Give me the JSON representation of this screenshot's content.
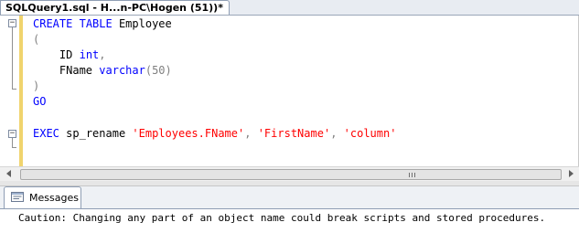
{
  "editor_tab": {
    "title": "SQLQuery1.sql - H...n-PC\\Hogen (51))*"
  },
  "code": {
    "l1": {
      "kw1": "CREATE",
      "kw2": "TABLE",
      "name": "Employee"
    },
    "l2": {
      "paren": "("
    },
    "l3": {
      "col": "ID",
      "type": "int",
      "comma": ","
    },
    "l4": {
      "col": "FName",
      "type": "varchar",
      "args": "(50)"
    },
    "l5": {
      "paren": ")"
    },
    "l6": {
      "kw": "GO"
    },
    "l7": {
      "kw": "EXEC",
      "proc": "sp_rename",
      "arg1": "'Employees.FName'",
      "arg2": "'FirstName'",
      "arg3": "'column'",
      "sep": ","
    }
  },
  "results": {
    "tab_label": "Messages",
    "message": "Caution: Changing any part of an object name could break scripts and stored procedures."
  },
  "icons": {
    "collapse": "collapse-box-icon",
    "messages": "messages-icon",
    "scroll_left": "scroll-left-arrow-icon",
    "scroll_right": "scroll-right-arrow-icon"
  }
}
